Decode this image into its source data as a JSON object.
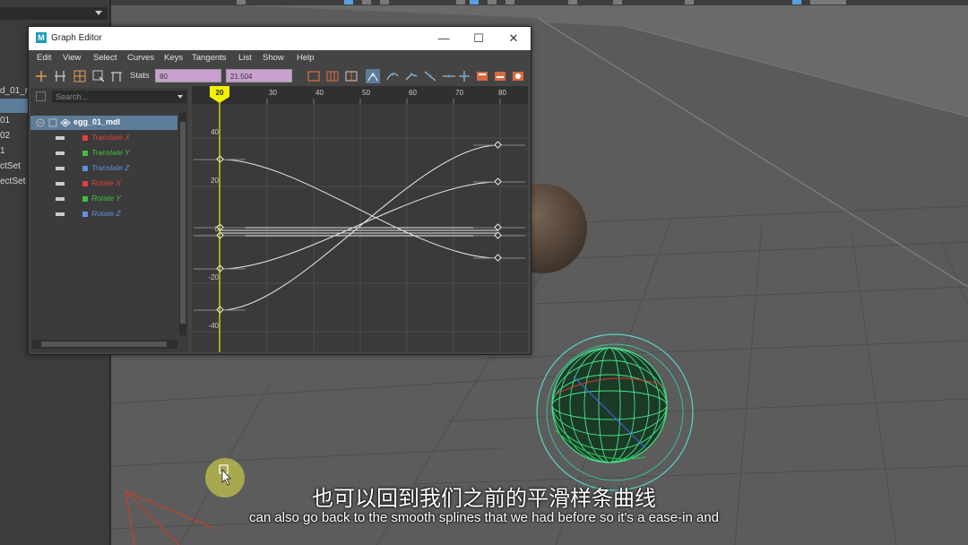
{
  "window": {
    "title": "Graph Editor",
    "logo": "M",
    "minimize_icon": "minimize-icon",
    "maximize_icon": "maximize-icon",
    "close_icon": "close-icon"
  },
  "menu": [
    "Edit",
    "View",
    "Select",
    "Curves",
    "Keys",
    "Tangents",
    "List",
    "Show",
    "Help"
  ],
  "toolbar": {
    "stats_label": "Stats",
    "stat_value_1": "80",
    "stat_value_2": "21.504",
    "field_color": "#c9a0d0"
  },
  "outliner": {
    "search_placeholder": "Search...",
    "node": "egg_01_mdl",
    "channels": [
      {
        "label": "Translate X",
        "color": "#e04040"
      },
      {
        "label": "Translate Y",
        "color": "#40c040"
      },
      {
        "label": "Translate Z",
        "color": "#5f8fe0"
      },
      {
        "label": "Rotate X",
        "color": "#e04040"
      },
      {
        "label": "Rotate Y",
        "color": "#40c040"
      },
      {
        "label": "Rotate Z",
        "color": "#5f8fe0"
      }
    ]
  },
  "graph": {
    "current_frame": "20",
    "frame_ticks": [
      "30",
      "40",
      "50",
      "60",
      "70",
      "80"
    ],
    "value_ticks": [
      "40",
      "20",
      "0",
      "-20",
      "-40"
    ],
    "curve_color": "#e8e8e8",
    "playhead_color": "#f2f000"
  },
  "scene_outliner": {
    "items": [
      "d_01_m",
      "01",
      "02",
      "1",
      "ctSet",
      "ectSet"
    ],
    "selection_color": "#5d7c99"
  },
  "subtitles": {
    "chinese": "也可以回到我们之前的平滑样条曲线",
    "english": "can also go back to the smooth splines that we had before so it's a ease-in and"
  }
}
